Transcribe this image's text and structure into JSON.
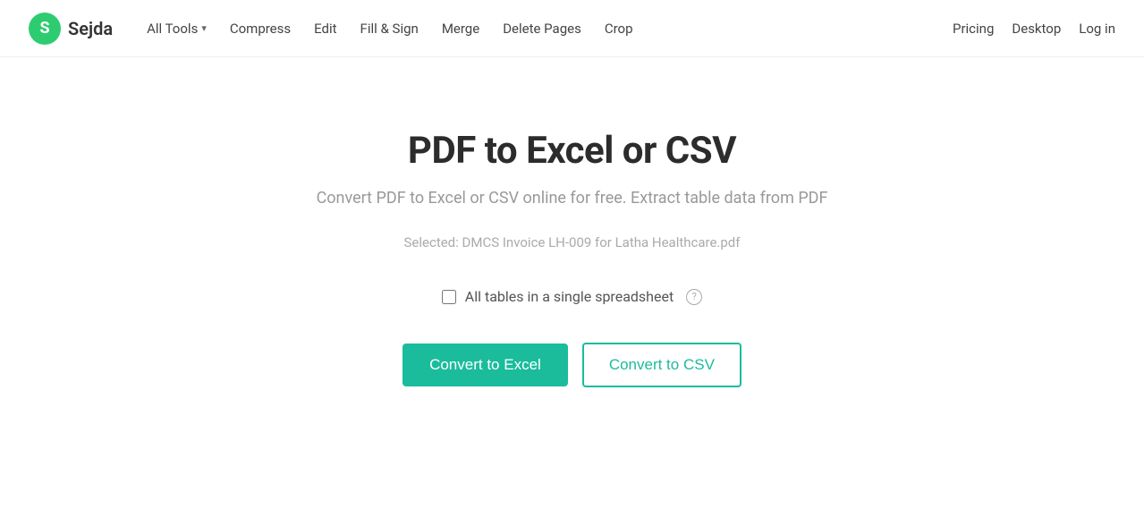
{
  "logo": {
    "letter": "S",
    "text": "Sejda"
  },
  "nav": {
    "all_tools_label": "All Tools",
    "items": [
      {
        "label": "Compress",
        "id": "compress"
      },
      {
        "label": "Edit",
        "id": "edit"
      },
      {
        "label": "Fill & Sign",
        "id": "fill-sign"
      },
      {
        "label": "Merge",
        "id": "merge"
      },
      {
        "label": "Delete Pages",
        "id": "delete-pages"
      },
      {
        "label": "Crop",
        "id": "crop"
      }
    ],
    "right_items": [
      {
        "label": "Pricing",
        "id": "pricing"
      },
      {
        "label": "Desktop",
        "id": "desktop"
      },
      {
        "label": "Log in",
        "id": "login"
      }
    ]
  },
  "main": {
    "title": "PDF to Excel or CSV",
    "subtitle": "Convert PDF to Excel or CSV online for free. Extract table data from PDF",
    "selected_file_label": "Selected:",
    "selected_file_name": "DMCS Invoice LH-009 for Latha Healthcare.pdf",
    "checkbox_label": "All tables in a single spreadsheet",
    "help_symbol": "?",
    "convert_excel_btn": "Convert to Excel",
    "convert_csv_btn": "Convert to CSV"
  },
  "colors": {
    "brand_green": "#1abc9c",
    "logo_green": "#2ecc71"
  }
}
